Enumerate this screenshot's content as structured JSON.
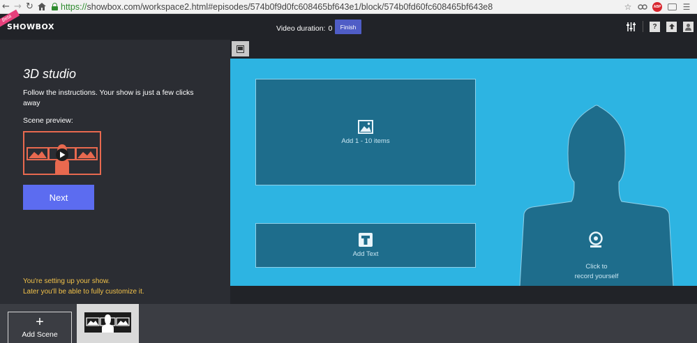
{
  "browser": {
    "url_scheme": "https://",
    "url_rest": "showbox.com/workspace2.html#episodes/574b0f9d0fc608465bf643e1/block/574b0fd60fc608465bf643e8",
    "abp_label": "ABP"
  },
  "header": {
    "logo": "SHOWBOX",
    "beta": "Beta",
    "duration_label": "Video duration:",
    "duration_value": "0",
    "finish_label": "Finish"
  },
  "left_panel": {
    "title": "3D studio",
    "instructions": "Follow the instructions. Your show is just a few clicks away",
    "scene_preview_label": "Scene preview:",
    "next_label": "Next",
    "setup_note_line1": "You're setting up your show.",
    "setup_note_line2": "Later you'll be able to fully customize it."
  },
  "stage": {
    "media_slot_label": "Add 1 - 10 items",
    "text_slot_label": "Add Text",
    "record_label_line1": "Click to",
    "record_label_line2": "record yourself"
  },
  "bottom_bar": {
    "add_scene_label": "Add Scene"
  },
  "colors": {
    "stage": "#2db4e2",
    "slot": "#1e6d8c",
    "accent_button": "#5c6cf0",
    "finish_button": "#4f5dc6",
    "preview_border": "#e8694f",
    "note_text": "#f2c24a"
  }
}
